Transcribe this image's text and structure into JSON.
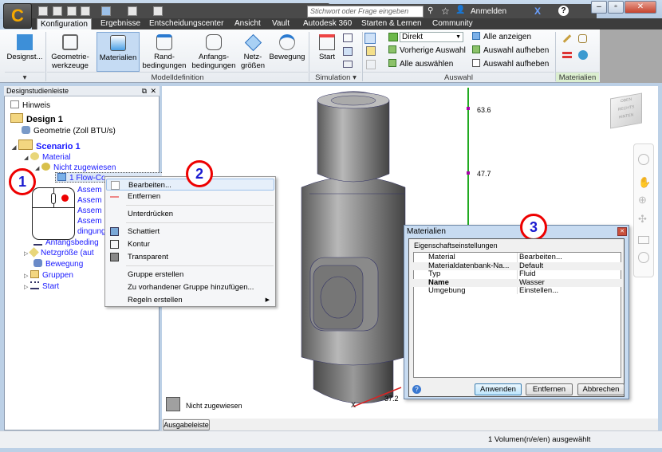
{
  "titlebar": {
    "search_placeholder": "Stichwort oder Frage eingeben",
    "signin": "Anmelden",
    "help": "?",
    "app_logo": "C"
  },
  "tabs": [
    "Konfiguration",
    "Ergebnisse",
    "Entscheidungscenter",
    "Ansicht",
    "Vault",
    "Autodesk 360",
    "Starten & Lernen",
    "Community"
  ],
  "ribbon": {
    "designst": "Designst...",
    "buttons": [
      {
        "l1": "Geometrie-",
        "l2": "werkzeuge"
      },
      {
        "l1": "Materialien",
        "l2": ""
      },
      {
        "l1": "Rand-",
        "l2": "bedingungen"
      },
      {
        "l1": "Anfangs-",
        "l2": "bedingungen"
      },
      {
        "l1": "Netz-",
        "l2": "größen"
      },
      {
        "l1": "Bewegung",
        "l2": ""
      }
    ],
    "groups": {
      "modell": "Modelldefinition",
      "simulation": "Simulation",
      "auswahl": "Auswahl",
      "materialien": "Materialien"
    },
    "start": "Start",
    "select_mode": "Direkt",
    "auswahl_items": [
      "Vorherige Auswahl",
      "Alle auswählen",
      "Alle anzeigen",
      "Auswahl aufheben",
      "Auswahl aufheben"
    ]
  },
  "panel": {
    "title": "Designstudienleiste",
    "tree": [
      "Hinweis",
      "Design 1",
      "Geometrie (Zoll BTU/s)",
      "Scenario 1",
      "Material",
      "Nicht zugewiesen",
      "1 Flow-Co",
      "Assem",
      "Assem",
      "Assem",
      "Assem",
      "dingung",
      "Anfangsbeding",
      "Netzgröße (aut",
      "Bewegung",
      "Gruppen",
      "Start"
    ]
  },
  "context_menu": [
    "Bearbeiten...",
    "Entfernen",
    "Unterdrücken",
    "Schattiert",
    "Kontur",
    "Transparent",
    "Gruppe erstellen",
    "Zu vorhandener Gruppe hinzufügen...",
    "Regeln erstellen"
  ],
  "callouts": [
    "1",
    "2",
    "3"
  ],
  "viewport": {
    "axis_labels": [
      "63.6",
      "47.7",
      "37.2"
    ],
    "axis_x": "X",
    "legend": "Nicht zugewiesen",
    "legend_color": "#a0a0a0",
    "viewcube": [
      "OBEN",
      "RECHTS",
      "HINTEN"
    ]
  },
  "output_button": "Ausgabeleiste",
  "dialog": {
    "title": "Materialien",
    "group": "Eigenschaftseinstellungen",
    "rows": [
      {
        "k": "Material",
        "v": "Bearbeiten..."
      },
      {
        "k": "Materialdatenbank-Na...",
        "v": "Default"
      },
      {
        "k": "Typ",
        "v": "Fluid"
      },
      {
        "k": "Name",
        "v": "Wasser"
      },
      {
        "k": "Umgebung",
        "v": "Einstellen..."
      }
    ],
    "buttons": [
      "Anwenden",
      "Entfernen",
      "Abbrechen"
    ]
  },
  "status": "1 Volumen(n/e/en) ausgewählt"
}
